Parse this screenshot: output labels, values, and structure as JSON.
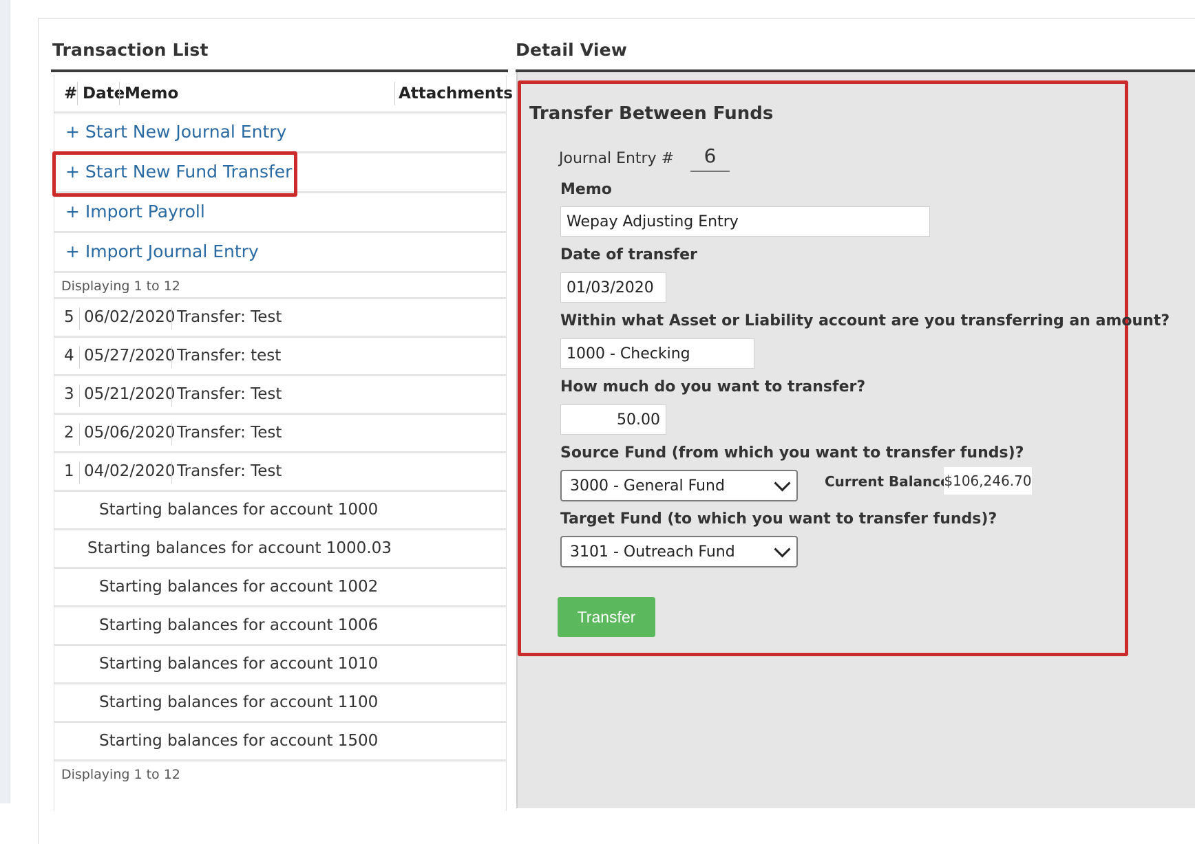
{
  "transaction_list": {
    "title": "Transaction List",
    "headers": {
      "num": "#",
      "date": "Date",
      "memo": "Memo",
      "attachments": "Attachments"
    },
    "actions": [
      "+ Start New Journal Entry",
      "+ Start New Fund Transfer",
      "+ Import Payroll",
      "+ Import Journal Entry"
    ],
    "displaying_top": "Displaying   1 to 12",
    "transactions": [
      {
        "num": "5",
        "date": "06/02/2020",
        "memo": "Transfer: Test"
      },
      {
        "num": "4",
        "date": "05/27/2020",
        "memo": "Transfer: test"
      },
      {
        "num": "3",
        "date": "05/21/2020",
        "memo": "Transfer: Test"
      },
      {
        "num": "2",
        "date": "05/06/2020",
        "memo": "Transfer: Test"
      },
      {
        "num": "1",
        "date": "04/02/2020",
        "memo": "Transfer: Test"
      }
    ],
    "balances": [
      "Starting balances for account 1000",
      "Starting balances for account 1000.03",
      "Starting balances for account 1002",
      "Starting balances for account 1006",
      "Starting balances for account 1010",
      "Starting balances for account 1100",
      "Starting balances for account 1500"
    ],
    "displaying_bottom": "Displaying   1 to 12"
  },
  "detail_view": {
    "title": "Detail View",
    "form_title": "Transfer Between Funds",
    "journal_entry_label": "Journal Entry #",
    "journal_entry_number": "6",
    "memo_label": "Memo",
    "memo_value": "Wepay Adjusting Entry",
    "date_label": "Date of transfer",
    "date_value": "01/03/2020",
    "account_label": "Within what Asset or Liability account are you transferring an amount?",
    "account_value": "1000 - Checking",
    "amount_label": "How much do you want to transfer?",
    "amount_value": "50.00",
    "source_label": "Source Fund (from which you want to transfer funds)?",
    "source_value": "3000 - General Fund",
    "current_balance_label": "Current Balance:",
    "current_balance_value": "$106,246.70",
    "target_label": "Target Fund (to which you want to transfer funds)?",
    "target_value": "3101 - Outreach Fund",
    "transfer_button": "Transfer"
  },
  "colors": {
    "highlight": "#cc2b2b",
    "link": "#2a6aa3",
    "button_green": "#5cb85c"
  }
}
